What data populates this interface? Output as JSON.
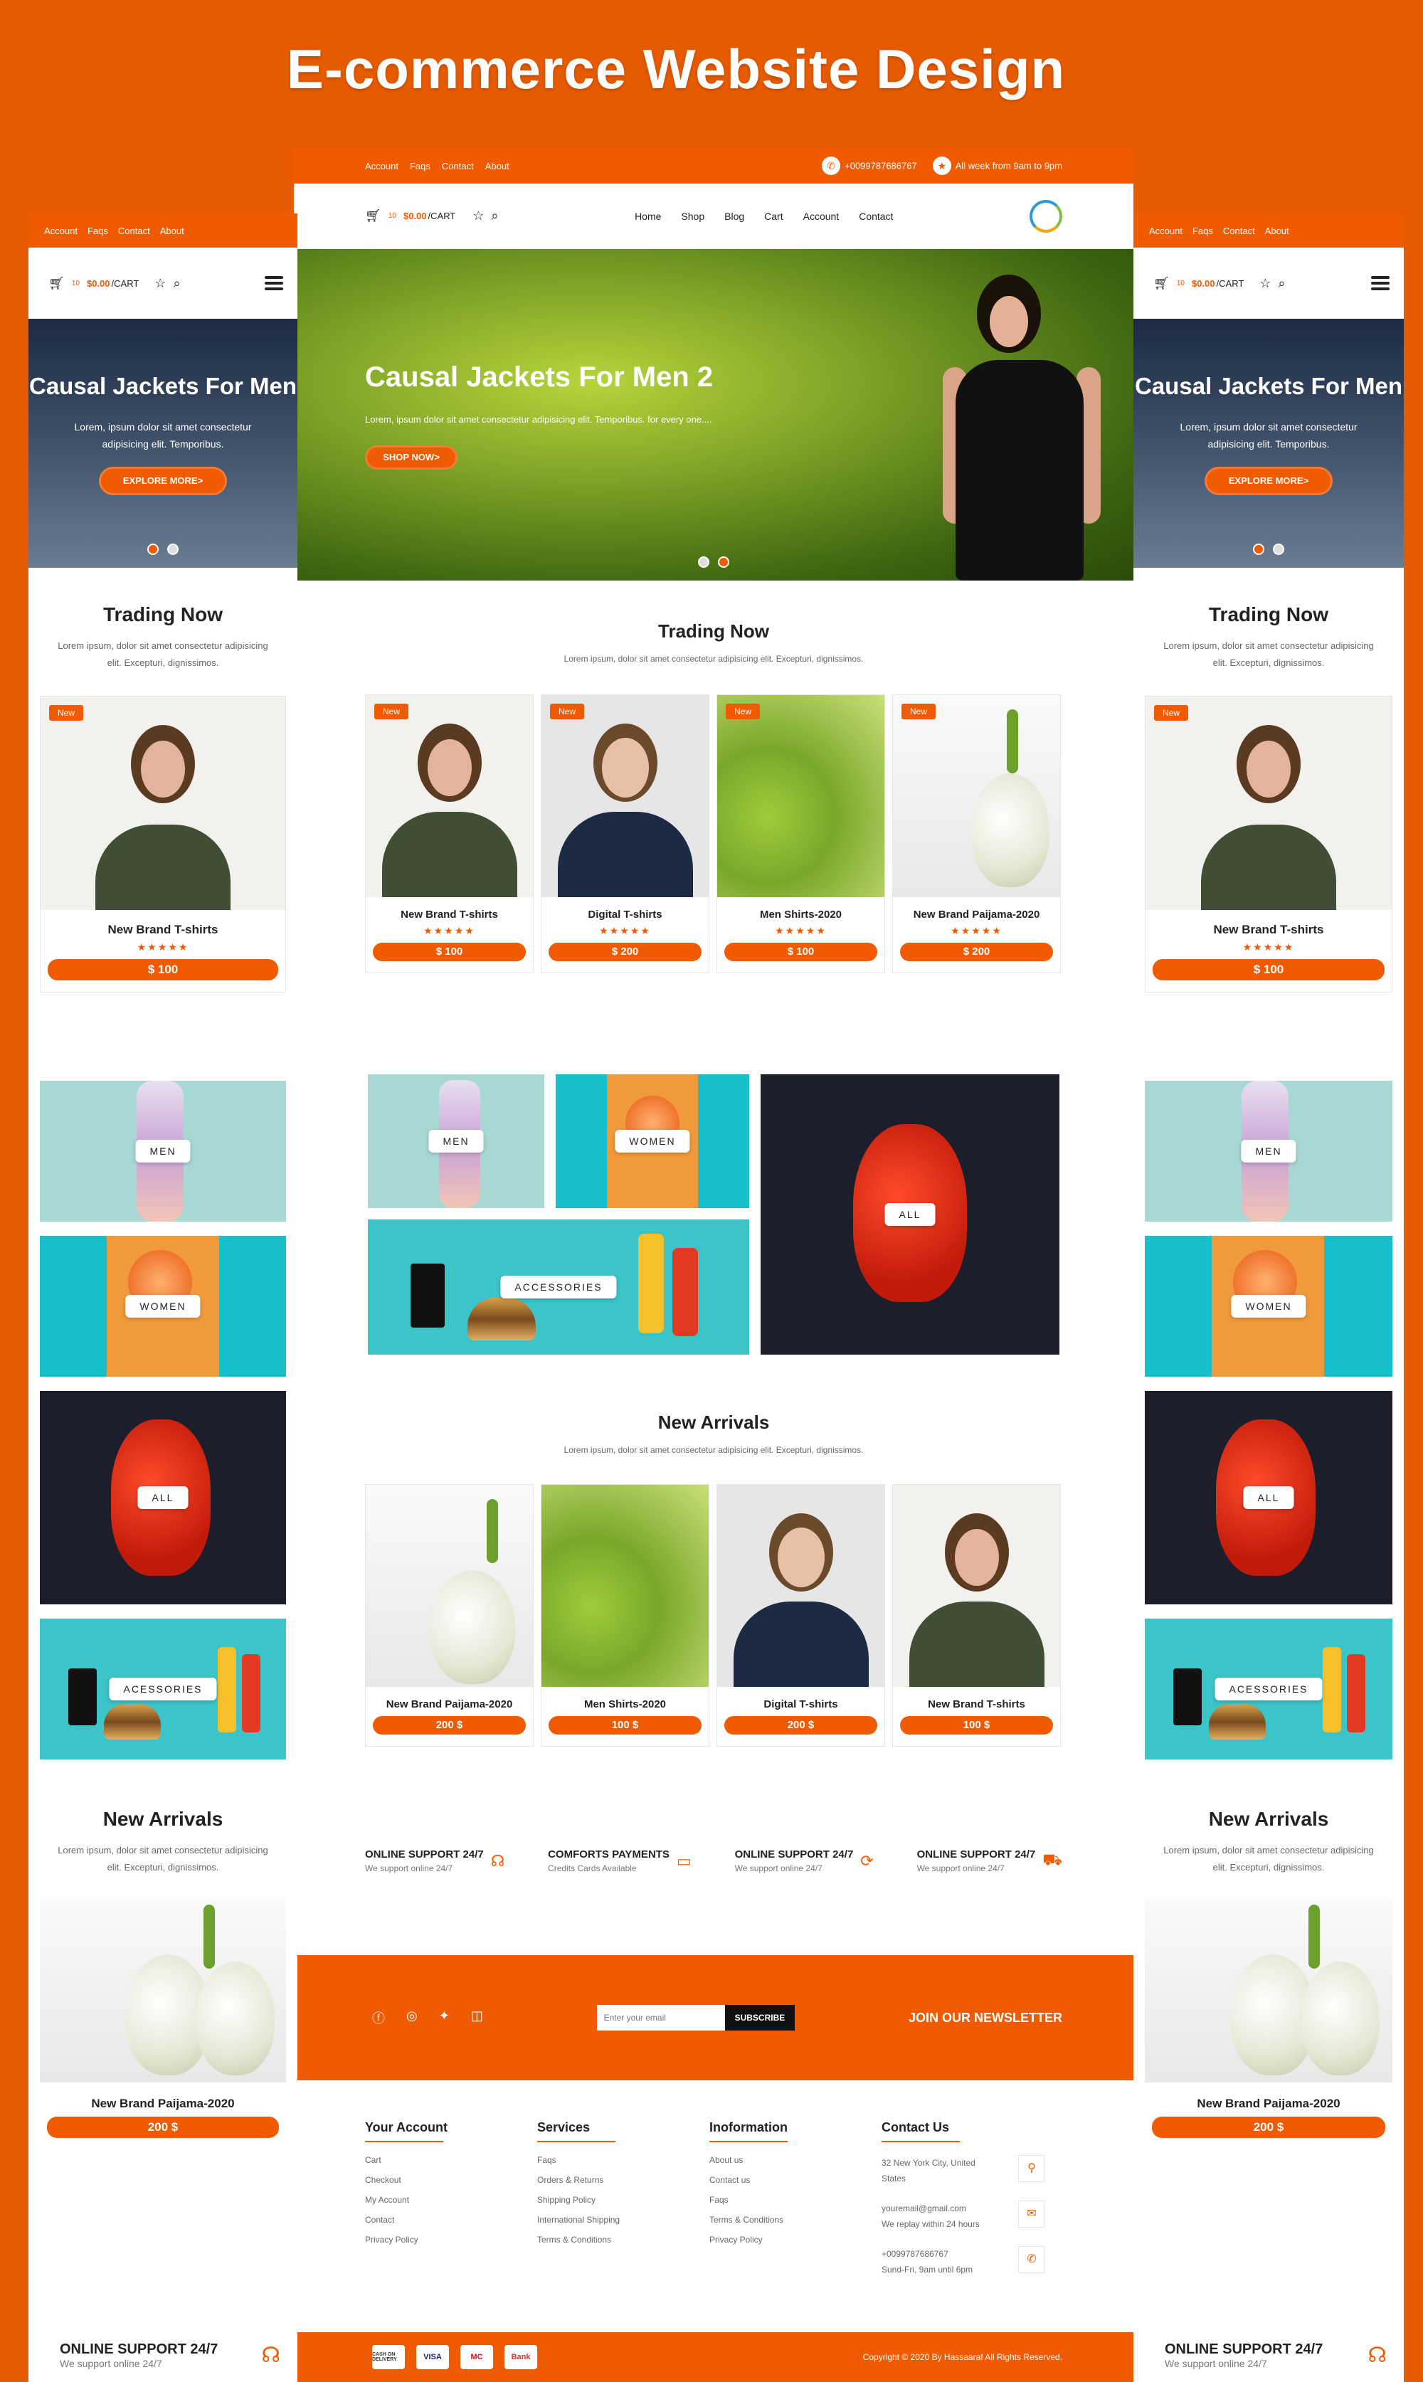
{
  "page_title": "E-commerce Website Design",
  "colors": {
    "accent": "#F05A00",
    "background": "#E65A00",
    "dark": "#111111"
  },
  "topbar": {
    "links": [
      "Account",
      "Faqs",
      "Contact",
      "About"
    ],
    "phone": "+0099787686767",
    "hours": "All week from 9am to 9pm"
  },
  "nav": {
    "cart_count": "10",
    "cart_price": "$0.00",
    "cart_label": "/CART",
    "menu": [
      "Home",
      "Shop",
      "Blog",
      "Cart",
      "Account",
      "Contact"
    ]
  },
  "hero": {
    "title": "Causal Jackets For Men 2",
    "text": "Lorem, ipsum dolor sit amet consectetur adipisicing elit. Temporibus. for every one....",
    "button": "SHOP NOW>"
  },
  "mobile_hero": {
    "title": "Causal Jackets For Men",
    "text": "Lorem, ipsum dolor sit amet consectetur adipisicing elit. Temporibus.",
    "button": "EXPLORE MORE>"
  },
  "trading": {
    "title": "Trading Now",
    "subtitle": "Lorem ipsum, dolor sit amet consectetur adipisicing elit. Excepturi, dignissimos.",
    "mobile_subtitle": "Lorem ipsum, dolor sit amet consectetur adipisicing elit. Excepturi, dignissimos.",
    "badge": "New",
    "stars": "★★★★★",
    "products": [
      {
        "name": "New Brand T-shirts",
        "price": "$ 100",
        "image": "woman"
      },
      {
        "name": "Digital T-shirts",
        "price": "$ 200",
        "image": "man"
      },
      {
        "name": "Men Shirts-2020",
        "price": "$ 100",
        "image": "romanesco"
      },
      {
        "name": "New Brand Paijama-2020",
        "price": "$ 200",
        "image": "fennel"
      }
    ]
  },
  "categories": {
    "men": "MEN",
    "women": "WOMEN",
    "all": "ALL",
    "accessories": "ACCESSORIES",
    "accessories_mobile": "ACESSORIES"
  },
  "arrivals": {
    "title": "New Arrivals",
    "subtitle": "Lorem ipsum, dolor sit amet consectetur adipisicing elit. Excepturi, dignissimos.",
    "products": [
      {
        "name": "New Brand Paijama-2020",
        "price": "200 $",
        "image": "fennel"
      },
      {
        "name": "Men Shirts-2020",
        "price": "100 $",
        "image": "romanesco"
      },
      {
        "name": "Digital T-shirts",
        "price": "200 $",
        "image": "man"
      },
      {
        "name": "New Brand T-shirts",
        "price": "100 $",
        "image": "woman"
      }
    ]
  },
  "features": [
    {
      "title": "ONLINE SUPPORT 24/7",
      "sub": "We support online 24/7",
      "icon": "headset-icon"
    },
    {
      "title": "COMFORTS PAYMENTS",
      "sub": "Credits Cards Available",
      "icon": "wallet-icon"
    },
    {
      "title": "ONLINE SUPPORT 24/7",
      "sub": "We support online 24/7",
      "icon": "refresh-icon"
    },
    {
      "title": "ONLINE SUPPORT 24/7",
      "sub": "We support online 24/7",
      "icon": "truck-icon"
    }
  ],
  "newsletter": {
    "placeholder": "Enter your email",
    "button": "SUBSCRIBE",
    "title": "JOIN OUR NEWSLETTER"
  },
  "footer": {
    "account": {
      "title": "Your Account",
      "links": [
        "Cart",
        "Checkout",
        "My Account",
        "Contact",
        "Privacy Policy"
      ]
    },
    "services": {
      "title": "Services",
      "links": [
        "Faqs",
        "Orders & Returns",
        "Shipping Policy",
        "International Shipping",
        "Terms & Conditions"
      ]
    },
    "info": {
      "title": "Inoformation",
      "links": [
        "About us",
        "Contact us",
        "Faqs",
        "Terms & Conditions",
        "Privacy Policy"
      ]
    },
    "contact": {
      "title": "Contact Us",
      "address": "32 New York City, United States",
      "email": "youremail@gmail.com",
      "email_note": "We replay within 24 hours",
      "phone": "+0099787686767",
      "phone_note": "Sund-Fri, 9am until 6pm"
    }
  },
  "bottom": {
    "copyright": "Copyright © 2020 By Hassaaraf All Rights Reserved.",
    "cards": [
      "CASH ON DELIVERY",
      "VISA",
      "MC",
      "Bank"
    ]
  }
}
